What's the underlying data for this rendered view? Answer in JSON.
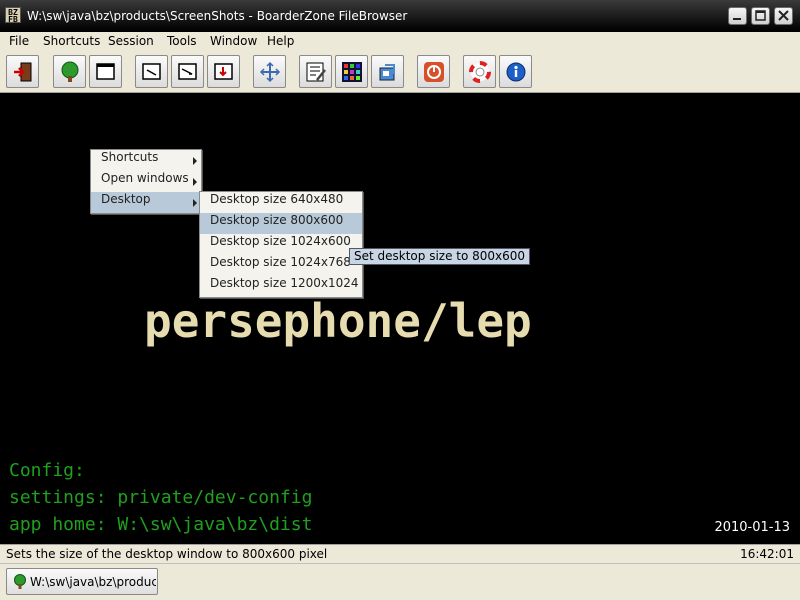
{
  "window": {
    "title": "W:\\sw\\java\\bz\\products\\ScreenShots - BoarderZone FileBrowser"
  },
  "menubar": {
    "items": [
      "File",
      "Shortcuts",
      "Session",
      "Tools",
      "Window",
      "Help"
    ]
  },
  "toolbar": {
    "buttons": [
      {
        "icon": "exit-icon"
      },
      {
        "icon": "tree-icon"
      },
      {
        "icon": "window-icon"
      },
      {
        "icon": "window-minimize-icon"
      },
      {
        "icon": "window-restore-icon"
      },
      {
        "icon": "window-down-icon"
      },
      {
        "icon": "arrange-icon"
      },
      {
        "icon": "edit-icon"
      },
      {
        "icon": "color-grid-icon"
      },
      {
        "icon": "network-icon"
      },
      {
        "icon": "power-icon"
      },
      {
        "icon": "lifebuoy-icon"
      },
      {
        "icon": "info-icon"
      }
    ]
  },
  "desktop": {
    "label": "persephone/lep",
    "config_lines": [
      "Config:",
      "settings: private/dev-config",
      "app home: W:\\sw\\java\\bz\\dist"
    ],
    "date": "2010-01-13"
  },
  "context_menu": {
    "items": [
      {
        "label": "Shortcuts"
      },
      {
        "label": "Open windows"
      },
      {
        "label": "Desktop"
      }
    ]
  },
  "desktop_submenu": {
    "items": [
      {
        "label": "Desktop size 640x480"
      },
      {
        "label": "Desktop size 800x600"
      },
      {
        "label": "Desktop size 1024x600"
      },
      {
        "label": "Desktop size 1024x768"
      },
      {
        "label": "Desktop size 1200x1024"
      }
    ]
  },
  "tooltip": "Set desktop size to 800x600",
  "statusbar": {
    "message": "Sets the size of the desktop window to 800x600 pixel",
    "time": "16:42:01"
  },
  "taskbar": {
    "task_label": "W:\\sw\\java\\bz\\produc..."
  },
  "colors": {
    "desktop_bg": "#000000",
    "label_color": "#e6dcb0",
    "config_color": "#1fa01f",
    "menu_selection": "#b8c9d9"
  }
}
